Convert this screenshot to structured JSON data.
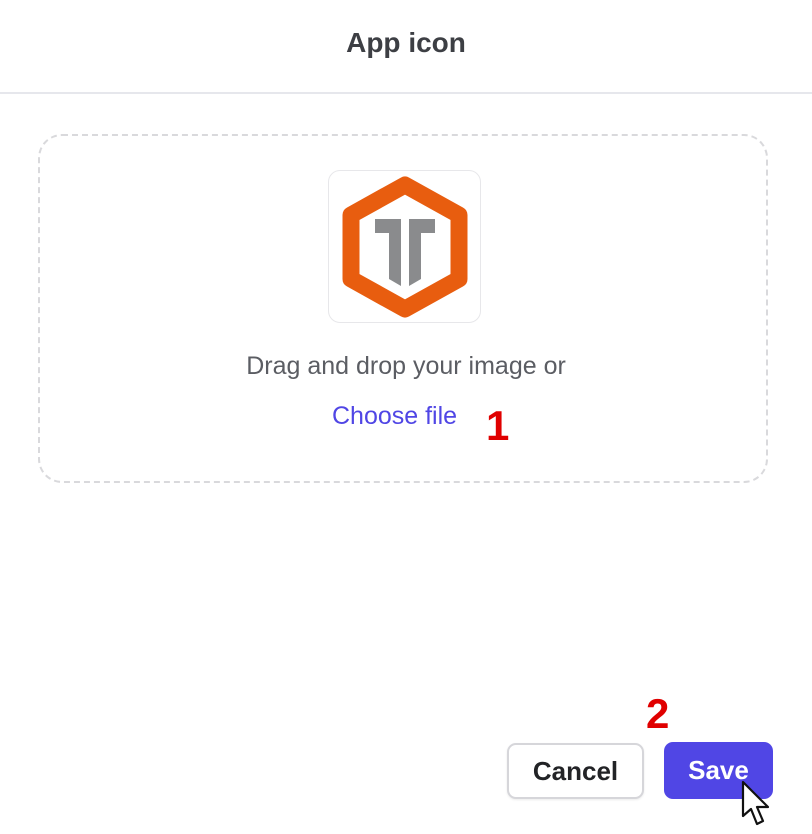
{
  "dialog": {
    "title": "App icon"
  },
  "upload": {
    "prompt": "Drag and drop your image or",
    "choose_label": "Choose file",
    "preview_icon": "hexagon-logo-icon",
    "logo_colors": {
      "hexagon": "#e85d0f",
      "letter": "#8a8b8d"
    }
  },
  "annotations": {
    "step_1": "1",
    "step_2": "2"
  },
  "footer": {
    "cancel_label": "Cancel",
    "save_label": "Save"
  },
  "colors": {
    "accent": "#5046e5",
    "annotation": "#e00000"
  }
}
